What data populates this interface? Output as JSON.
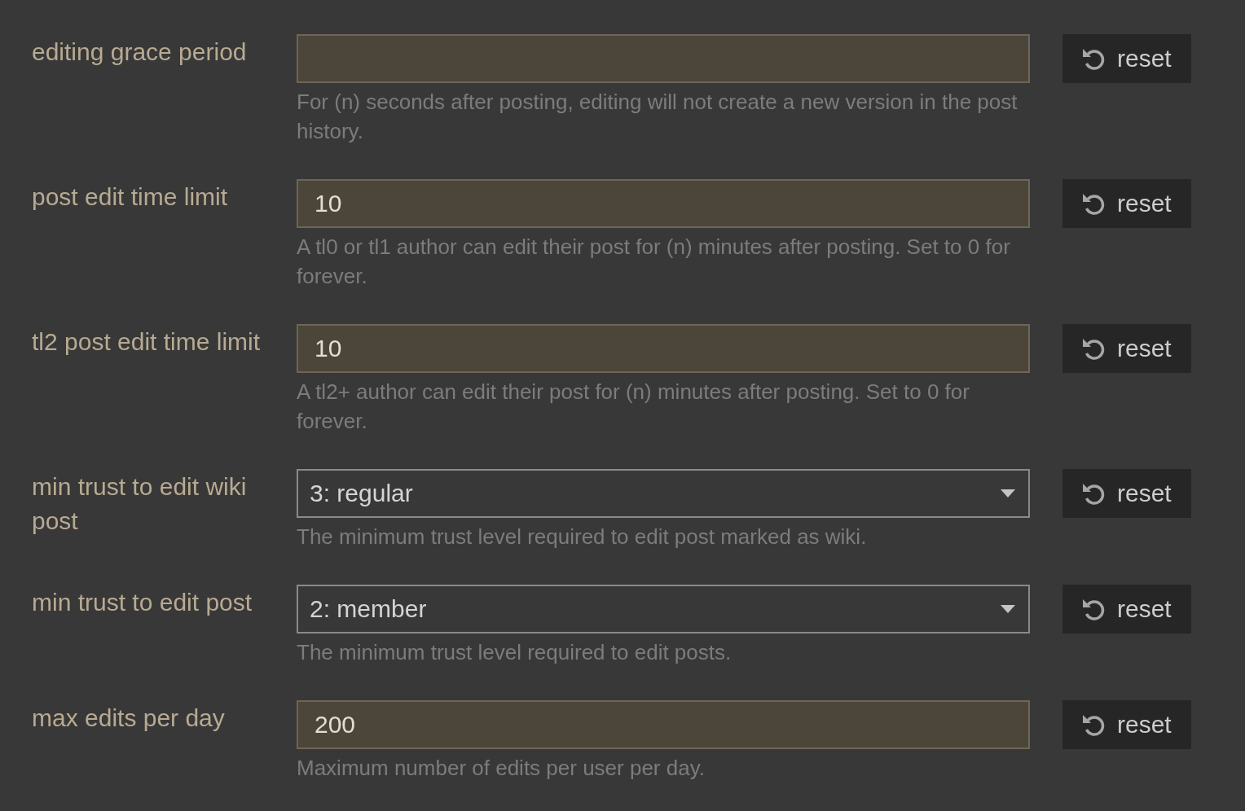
{
  "settings": [
    {
      "kind": "text",
      "label": "editing grace period",
      "description": "For (n) seconds after posting, editing will not create a new version in the post history.",
      "reset": "reset"
    },
    {
      "kind": "text",
      "label": "post edit time limit",
      "value": "10",
      "description": "A tl0 or tl1 author can edit their post for (n) minutes after posting. Set to 0 for forever.",
      "reset": "reset"
    },
    {
      "kind": "text",
      "label": "tl2 post edit time limit",
      "value": "10",
      "description": "A tl2+ author can edit their post for (n) minutes after posting. Set to 0 for forever.",
      "reset": "reset"
    },
    {
      "kind": "select",
      "label": "min trust to edit wiki post",
      "value": "3: regular",
      "description": "The minimum trust level required to edit post marked as wiki.",
      "reset": "reset"
    },
    {
      "kind": "select",
      "label": "min trust to edit post",
      "value": "2: member",
      "description": "The minimum trust level required to edit posts.",
      "reset": "reset"
    },
    {
      "kind": "text",
      "label": "max edits per day",
      "value": "200",
      "description": "Maximum number of edits per user per day.",
      "reset": "reset"
    }
  ]
}
